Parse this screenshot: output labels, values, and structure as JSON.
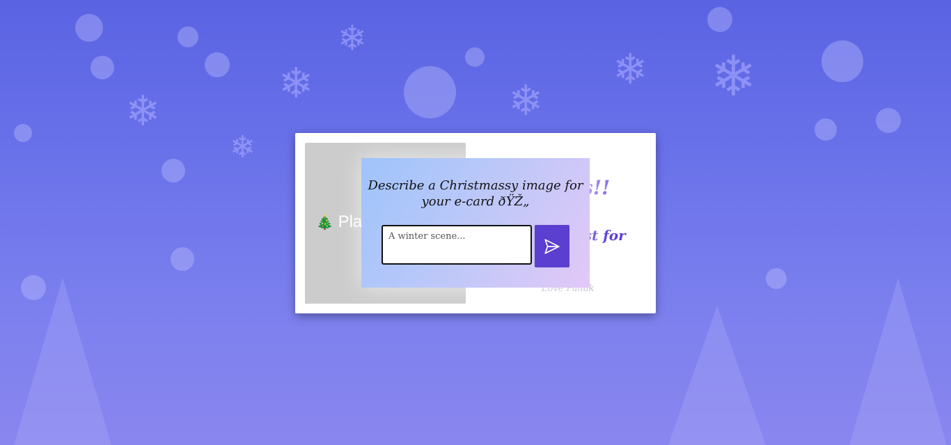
{
  "card": {
    "placeholder_emoji": "🎄",
    "placeholder_text": "Pla",
    "right_title_line1": "!",
    "right_title_line2": "s!!",
    "best_for": "est for",
    "signature": "Love Pallak"
  },
  "dialog": {
    "title": "Describe a Christmassy image for your e-card ðŸŽ„",
    "input_placeholder": "A winter scene...",
    "send_icon": "send-icon"
  },
  "colors": {
    "background": "#6a72ea",
    "accent": "#5a3fd0",
    "dialog_gradient_start": "#9ec4fb",
    "dialog_gradient_end": "#e2c8f7"
  }
}
